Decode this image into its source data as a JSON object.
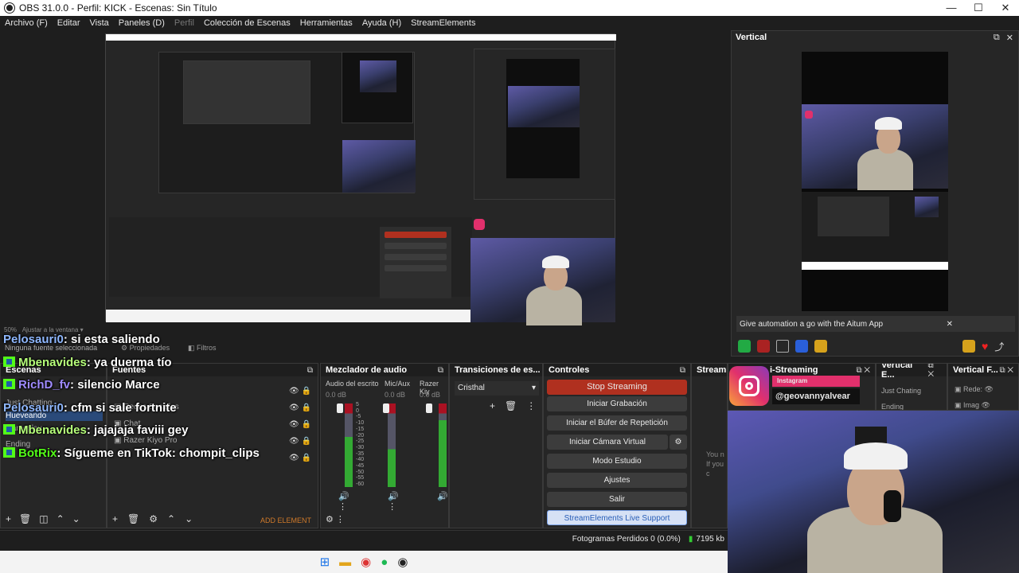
{
  "window": {
    "title": "OBS 31.0.0 - Perfil: KICK - Escenas: Sin Título",
    "controls": [
      "—",
      "☐",
      "✕"
    ]
  },
  "menu": [
    "Archivo (F)",
    "Editar",
    "Vista",
    "Paneles (D)",
    "Perfil",
    "Colección de Escenas",
    "Herramientas",
    "Ayuda (H)",
    "StreamElements"
  ],
  "vertical": {
    "title": "Vertical",
    "banner_text": "Give automation a go with the Aitum App",
    "banner_close": "✕"
  },
  "preview_status": {
    "zoom": "50%",
    "fit": "Ajustar a la ventana",
    "no_source": "Ninguna fuente seleccionada",
    "properties": "Propiedades",
    "filters": "Filtros"
  },
  "scenes": {
    "title": "Escenas",
    "items": [
      "Just Chatting",
      "Hueveando",
      "Gameplay",
      "Ending"
    ],
    "selected": "Hueveando"
  },
  "sources": {
    "title": "Fuentes",
    "items": [
      "Redes Sociales",
      "Chat",
      "Razer Kiyo Pro"
    ],
    "add_element": "ADD ELEMENT"
  },
  "mixer": {
    "title": "Mezclador de audio",
    "channels": [
      {
        "name": "Audio del escrito",
        "db": "0.0 dB"
      },
      {
        "name": "Mic/Aux",
        "db": "0.0 dB"
      },
      {
        "name": "Razer Kiy",
        "db": "0.0 dB"
      }
    ],
    "scale": [
      "5",
      "0",
      "-5",
      "-10",
      "-15",
      "-20",
      "-25",
      "-30",
      "-35",
      "-40",
      "-45",
      "-50",
      "-55",
      "-60"
    ]
  },
  "transitions": {
    "title": "Transiciones de es...",
    "selected": "Cristhal"
  },
  "controls": {
    "title": "Controles",
    "buttons": [
      "Stop Streaming",
      "Iniciar Grabación",
      "Iniciar el Búfer de Repetición",
      "Iniciar Cámara Virtual",
      "Modo Estudio",
      "Ajustes",
      "Salir",
      "StreamElements Live Support"
    ]
  },
  "more_docks": {
    "streamelements": "StreamEl",
    "multi": "i-Streaming",
    "vertical_escenas": "Vertical E...",
    "vertical_fuentes": "Vertical F...",
    "ve_items": [
      "Just Chating",
      "Ending"
    ],
    "vf_items": [
      "Rede:",
      "Imag"
    ],
    "notice": [
      "You n",
      "If you c"
    ]
  },
  "instagram": {
    "label": "Instagram",
    "handle": "@geovannyalvear"
  },
  "status": {
    "dropped": "Fotogramas Perdidos 0 (0.0%)",
    "bitrate": "7195 kb"
  },
  "chat": [
    {
      "user": "Pelosauri0",
      "color": "#8fb8ff",
      "msg": ": si esta saliendo",
      "badge": false
    },
    {
      "user": "Mbenavides",
      "color": "#b6ff7a",
      "msg": ": ya duerma tío",
      "badge": true
    },
    {
      "user": "RichD_fv",
      "color": "#9f8bff",
      "msg": ": silencio Marce",
      "badge": true
    },
    {
      "user": "Pelosauri0",
      "color": "#8fb8ff",
      "msg": ": cfm si sale fortnite",
      "badge": false
    },
    {
      "user": "Mbenavides",
      "color": "#b6ff7a",
      "msg": ": jajajaja faviii gey",
      "badge": true
    },
    {
      "user": "BotRix",
      "color": "#53fc18",
      "msg": ": Sígueme en TikTok: chompit_clips",
      "badge": true
    }
  ],
  "colors": {
    "accent_red": "#b0301f",
    "kick_green": "#53fc18",
    "instagram": "#e1306c",
    "selection_blue": "#2a5fb8"
  }
}
